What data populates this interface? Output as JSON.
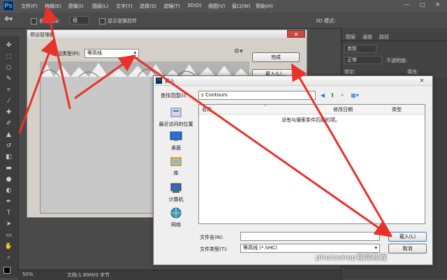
{
  "app": {
    "logo": "Ps",
    "menus": [
      "文件(F)",
      "编辑(E)",
      "图像(I)",
      "图层(L)",
      "文字(Y)",
      "选择(S)",
      "滤镜(T)",
      "3D(D)",
      "视图(V)",
      "窗口(W)",
      "帮助(H)"
    ],
    "window_controls": "— ▢ ✕"
  },
  "options_bar": {
    "auto_select_label": "自动选择:",
    "auto_select_value": "组",
    "show_transform_label": "显示变换控件",
    "mode_3d_label": "3D 模式:"
  },
  "right_panel": {
    "tabs": [
      "图层",
      "通道",
      "路径"
    ],
    "kind_label": "类型",
    "blend_value": "正常",
    "opacity_label": "不透明度:",
    "lock_label": "锁定:",
    "fill_label": "填充:"
  },
  "status": {
    "zoom": "50%",
    "doc_info": "文档:1.89M/0 字节"
  },
  "preset_manager": {
    "title": "预设管理器",
    "type_label": "预设类型(P):",
    "type_value": "等高线",
    "done_button": "完成",
    "load_button": "载入(L)...",
    "gear_icon": "gear-icon"
  },
  "load_dialog": {
    "title": "载入",
    "look_in_label": "查找范围(I):",
    "folder": "Contours",
    "columns": [
      "名称",
      "修改日期",
      "类型"
    ],
    "empty_message": "没有与搜索条件匹配的项。",
    "places": [
      {
        "label": "最近访问的位置",
        "icon": "recent-icon"
      },
      {
        "label": "桌面",
        "icon": "desktop-icon"
      },
      {
        "label": "库",
        "icon": "library-icon"
      },
      {
        "label": "计算机",
        "icon": "computer-icon"
      },
      {
        "label": "网络",
        "icon": "network-icon"
      }
    ],
    "filename_label": "文件名(N):",
    "filename_value": "",
    "filetype_label": "文件类型(T):",
    "filetype_value": "等高线 (*.SHC)",
    "load_button": "载入(L)",
    "cancel_button": "取消"
  },
  "watermark": "photoshop视频教程",
  "colors": {
    "arrow": "#e8322a",
    "ps_dark": "#535353",
    "dialog_bg": "#efefef"
  }
}
